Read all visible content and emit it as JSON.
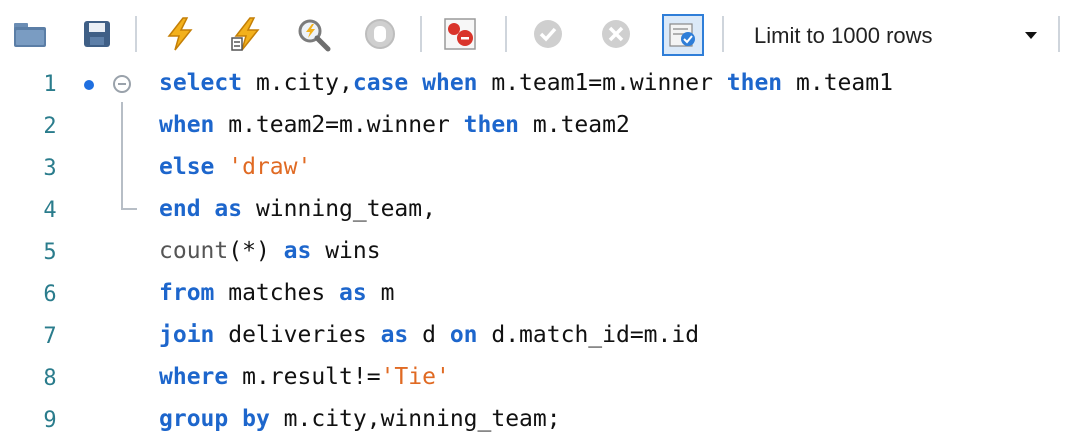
{
  "toolbar": {
    "buttons": [
      {
        "name": "open-folder-icon",
        "color": "#5b7ea6"
      },
      {
        "name": "save-icon",
        "color": "#3f5f86"
      },
      {
        "name": "execute-lightning-icon",
        "color": "#f3b11c"
      },
      {
        "name": "execute-current-lightning-icon",
        "color": "#f3b11c"
      },
      {
        "name": "explain-magnifier-icon",
        "color": "#7c7c7c"
      },
      {
        "name": "stop-icon",
        "color": "#c7c7c7"
      },
      {
        "name": "stop-on-error-icon",
        "color": "#d9342b"
      },
      {
        "name": "commit-check-icon",
        "color": "#c9c9c9"
      },
      {
        "name": "rollback-x-icon",
        "color": "#c9c9c9"
      },
      {
        "name": "autocommit-toggle-icon",
        "color": "#2f7ed8"
      }
    ],
    "limit_label": "Limit to 1000 rows"
  },
  "editor": {
    "lines": [
      {
        "num": "1",
        "tokens": [
          {
            "t": "select",
            "c": "kw"
          },
          {
            "t": " m.city,",
            "c": "id"
          },
          {
            "t": "case",
            "c": "kw"
          },
          {
            "t": " ",
            "c": "id"
          },
          {
            "t": "when",
            "c": "kw"
          },
          {
            "t": " m.team1=m.winner ",
            "c": "id"
          },
          {
            "t": "then",
            "c": "kw"
          },
          {
            "t": " m.team1",
            "c": "id"
          }
        ]
      },
      {
        "num": "2",
        "tokens": [
          {
            "t": "when",
            "c": "kw"
          },
          {
            "t": " m.team2=m.winner ",
            "c": "id"
          },
          {
            "t": "then",
            "c": "kw"
          },
          {
            "t": " m.team2",
            "c": "id"
          }
        ]
      },
      {
        "num": "3",
        "tokens": [
          {
            "t": "else",
            "c": "kw"
          },
          {
            "t": " ",
            "c": "id"
          },
          {
            "t": "'draw'",
            "c": "str"
          }
        ]
      },
      {
        "num": "4",
        "tokens": [
          {
            "t": "end",
            "c": "kw"
          },
          {
            "t": " ",
            "c": "id"
          },
          {
            "t": "as",
            "c": "kw"
          },
          {
            "t": " winning_team,",
            "c": "id"
          }
        ]
      },
      {
        "num": "5",
        "tokens": [
          {
            "t": "count",
            "c": "fn"
          },
          {
            "t": "(*) ",
            "c": "id"
          },
          {
            "t": "as",
            "c": "kw"
          },
          {
            "t": " wins",
            "c": "id"
          }
        ]
      },
      {
        "num": "6",
        "tokens": [
          {
            "t": "from",
            "c": "kw"
          },
          {
            "t": " matches ",
            "c": "id"
          },
          {
            "t": "as",
            "c": "kw"
          },
          {
            "t": " m",
            "c": "id"
          }
        ]
      },
      {
        "num": "7",
        "tokens": [
          {
            "t": "join",
            "c": "kw"
          },
          {
            "t": " deliveries ",
            "c": "id"
          },
          {
            "t": "as",
            "c": "kw"
          },
          {
            "t": " d ",
            "c": "id"
          },
          {
            "t": "on",
            "c": "kw"
          },
          {
            "t": " d.match_id=m.id",
            "c": "id"
          }
        ]
      },
      {
        "num": "8",
        "tokens": [
          {
            "t": "where",
            "c": "kw"
          },
          {
            "t": " m.result!=",
            "c": "id"
          },
          {
            "t": "'Tie'",
            "c": "str"
          }
        ]
      },
      {
        "num": "9",
        "tokens": [
          {
            "t": "group",
            "c": "kw"
          },
          {
            "t": " ",
            "c": "id"
          },
          {
            "t": "by",
            "c": "kw"
          },
          {
            "t": " m.city,winning_team;",
            "c": "id"
          }
        ]
      }
    ]
  }
}
